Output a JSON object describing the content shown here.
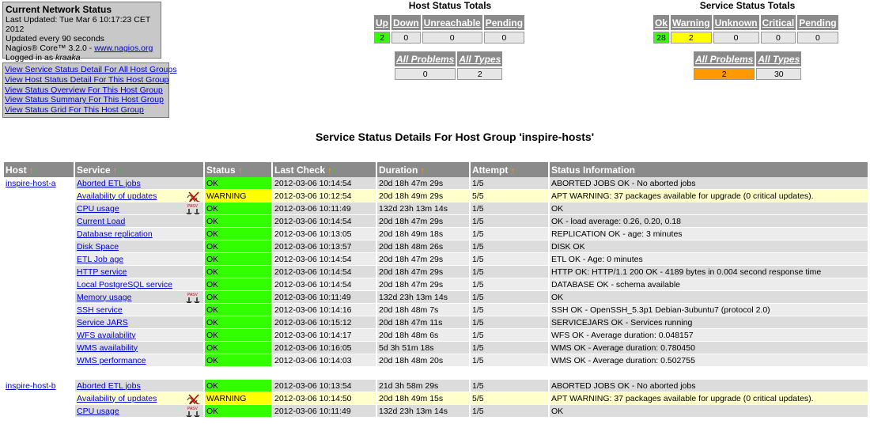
{
  "info": {
    "title": "Current Network Status",
    "last_updated": "Last Updated: Tue Mar 6 10:17:23 CET 2012",
    "update_interval": "Updated every 90 seconds",
    "version_prefix": "Nagios® Core™ 3.2.0 - ",
    "version_link": "www.nagios.org",
    "logged_in_prefix": "Logged in as ",
    "user": "kraaka"
  },
  "links": [
    "View Service Status Detail For All Host Groups",
    "View Host Status Detail For This Host Group",
    "View Status Overview For This Host Group",
    "View Status Summary For This Host Group",
    "View Status Grid For This Host Group"
  ],
  "host_totals": {
    "title": "Host Status Totals",
    "headers": [
      "Up",
      "Down",
      "Unreachable",
      "Pending"
    ],
    "values": [
      "2",
      "0",
      "0",
      "0"
    ],
    "problem_headers": [
      "All Problems",
      "All Types"
    ],
    "problem_values": [
      "0",
      "2"
    ]
  },
  "service_totals": {
    "title": "Service Status Totals",
    "headers": [
      "Ok",
      "Warning",
      "Unknown",
      "Critical",
      "Pending"
    ],
    "values": [
      "28",
      "2",
      "0",
      "0",
      "0"
    ],
    "problem_headers": [
      "All Problems",
      "All Types"
    ],
    "problem_values": [
      "2",
      "30"
    ]
  },
  "page_title": "Service Status Details For Host Group 'inspire-hosts'",
  "table": {
    "headers": [
      "Host",
      "Service",
      "Status",
      "Last Check",
      "Duration",
      "Attempt",
      "Status Information"
    ],
    "sort_icons": "↑↓",
    "rows": [
      {
        "host": "inspire-host-a",
        "service": "Aborted ETL jobs",
        "status": "OK",
        "last_check": "2012-03-06 10:14:54",
        "duration": "20d 18h 47m 29s",
        "attempt": "1/5",
        "info": "ABORTED JOBS OK - No aborted jobs"
      },
      {
        "host": "",
        "service": "Availability of updates",
        "status": "WARNING",
        "last_check": "2012-03-06 10:12:54",
        "duration": "20d 18h 49m 29s",
        "attempt": "5/5",
        "info": "APT WARNING: 37 packages available for upgrade (0 critical updates)."
      },
      {
        "host": "",
        "service": "CPU usage",
        "status": "OK",
        "last_check": "2012-03-06 10:11:49",
        "duration": "132d 23h 13m 14s",
        "attempt": "1/5",
        "info": "OK"
      },
      {
        "host": "",
        "service": "Current Load",
        "status": "OK",
        "last_check": "2012-03-06 10:14:54",
        "duration": "20d 18h 47m 29s",
        "attempt": "1/5",
        "info": "OK - load average: 0.26, 0.20, 0.18"
      },
      {
        "host": "",
        "service": "Database replication",
        "status": "OK",
        "last_check": "2012-03-06 10:13:05",
        "duration": "20d 18h 49m 18s",
        "attempt": "1/5",
        "info": "REPLICATION OK - age: 3 minutes"
      },
      {
        "host": "",
        "service": "Disk Space",
        "status": "OK",
        "last_check": "2012-03-06 10:13:57",
        "duration": "20d 18h 48m 26s",
        "attempt": "1/5",
        "info": "DISK OK"
      },
      {
        "host": "",
        "service": "ETL Job age",
        "status": "OK",
        "last_check": "2012-03-06 10:14:54",
        "duration": "20d 18h 47m 29s",
        "attempt": "1/5",
        "info": "ETL OK - Age: 0 minutes"
      },
      {
        "host": "",
        "service": "HTTP service",
        "status": "OK",
        "last_check": "2012-03-06 10:14:54",
        "duration": "20d 18h 47m 29s",
        "attempt": "1/5",
        "info": "HTTP OK: HTTP/1.1 200 OK - 4189 bytes in 0.004 second response time"
      },
      {
        "host": "",
        "service": "Local PostgreSQL service",
        "status": "OK",
        "last_check": "2012-03-06 10:14:54",
        "duration": "20d 18h 47m 29s",
        "attempt": "1/5",
        "info": "DATABASE OK - schema available"
      },
      {
        "host": "",
        "service": "Memory usage",
        "status": "OK",
        "last_check": "2012-03-06 10:11:49",
        "duration": "132d 23h 13m 14s",
        "attempt": "1/5",
        "info": "OK"
      },
      {
        "host": "",
        "service": "SSH service",
        "status": "OK",
        "last_check": "2012-03-06 10:14:16",
        "duration": "20d 18h 48m 7s",
        "attempt": "1/5",
        "info": "SSH OK - OpenSSH_5.3p1 Debian-3ubuntu7 (protocol 2.0)"
      },
      {
        "host": "",
        "service": "Service JARS",
        "status": "OK",
        "last_check": "2012-03-06 10:15:12",
        "duration": "20d 18h 47m 11s",
        "attempt": "1/5",
        "info": "SERVICEJARS OK - Services running"
      },
      {
        "host": "",
        "service": "WFS availability",
        "status": "OK",
        "last_check": "2012-03-06 10:14:17",
        "duration": "20d 18h 48m 6s",
        "attempt": "1/5",
        "info": "WFS OK - Average duration: 0.048157"
      },
      {
        "host": "",
        "service": "WMS availability",
        "status": "OK",
        "last_check": "2012-03-06 10:16:05",
        "duration": "5d 3h 51m 18s",
        "attempt": "1/5",
        "info": "WMS OK - Average duration: 0.780450"
      },
      {
        "host": "",
        "service": "WMS performance",
        "status": "OK",
        "last_check": "2012-03-06 10:14:03",
        "duration": "20d 18h 48m 20s",
        "attempt": "1/5",
        "info": "WMS OK - Average duration: 0.502755"
      },
      {
        "host": "inspire-host-b",
        "service": "Aborted ETL jobs",
        "status": "OK",
        "last_check": "2012-03-06 10:13:54",
        "duration": "21d 3h 58m 29s",
        "attempt": "1/5",
        "info": "ABORTED JOBS OK - No aborted jobs"
      },
      {
        "host": "",
        "service": "Availability of updates",
        "status": "WARNING",
        "last_check": "2012-03-06 10:14:50",
        "duration": "20d 18h 49m 15s",
        "attempt": "5/5",
        "info": "APT WARNING: 37 packages available for upgrade (0 critical updates)."
      },
      {
        "host": "",
        "service": "CPU usage",
        "status": "OK",
        "last_check": "2012-03-06 10:11:49",
        "duration": "132d 23h 13m 14s",
        "attempt": "1/5",
        "info": "OK"
      }
    ]
  },
  "icons": {
    "flapping": "flapping-disabled-icon",
    "passive": "passive-check-icon",
    "passive_label": "PASV"
  },
  "colors": {
    "header_bg": "#8a8a8a",
    "ok": "#33ff00",
    "warning": "#ffff00",
    "problems": "#ff9900"
  }
}
